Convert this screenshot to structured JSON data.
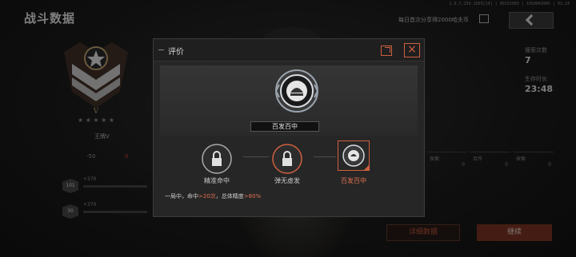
{
  "build_id": "1.0.7.150.1503[14] | 00191003 | 1050043985 | 03.24",
  "page_title": "战斗数据",
  "header": {
    "share_text": "每日首次分享得2000哈夫币"
  },
  "left_panel": {
    "rank_name": "王牌V",
    "rank_numeral": "V",
    "stats": {
      "left": "-50",
      "right": "0"
    },
    "levels": [
      {
        "level": "101",
        "xp": "+370"
      },
      {
        "level": "30",
        "xp": "+370"
      }
    ]
  },
  "right_panel": {
    "search_label": "搜索次数",
    "search_value": "7",
    "survival_label": "生存时长",
    "survival_value": "23:48",
    "cards": [
      {
        "label": "探索",
        "value": "0"
      },
      {
        "label": "合作",
        "value": "0"
      },
      {
        "label": "探索",
        "value": "0"
      }
    ],
    "detail_button": "详细数据",
    "continue_button": "继续"
  },
  "modal": {
    "title": "评价",
    "featured_medal": "百发百中",
    "achievements": [
      {
        "name": "精准命中",
        "state": "locked"
      },
      {
        "name": "弹无虚发",
        "state": "locked"
      },
      {
        "name": "百发百中",
        "state": "selected"
      }
    ],
    "criteria": {
      "prefix": "一局中，命中",
      "hits": ">20次",
      "mid": "，总体精度",
      "accuracy": ">80%"
    }
  },
  "colors": {
    "accent": "#d06040",
    "panel": "#262626"
  }
}
